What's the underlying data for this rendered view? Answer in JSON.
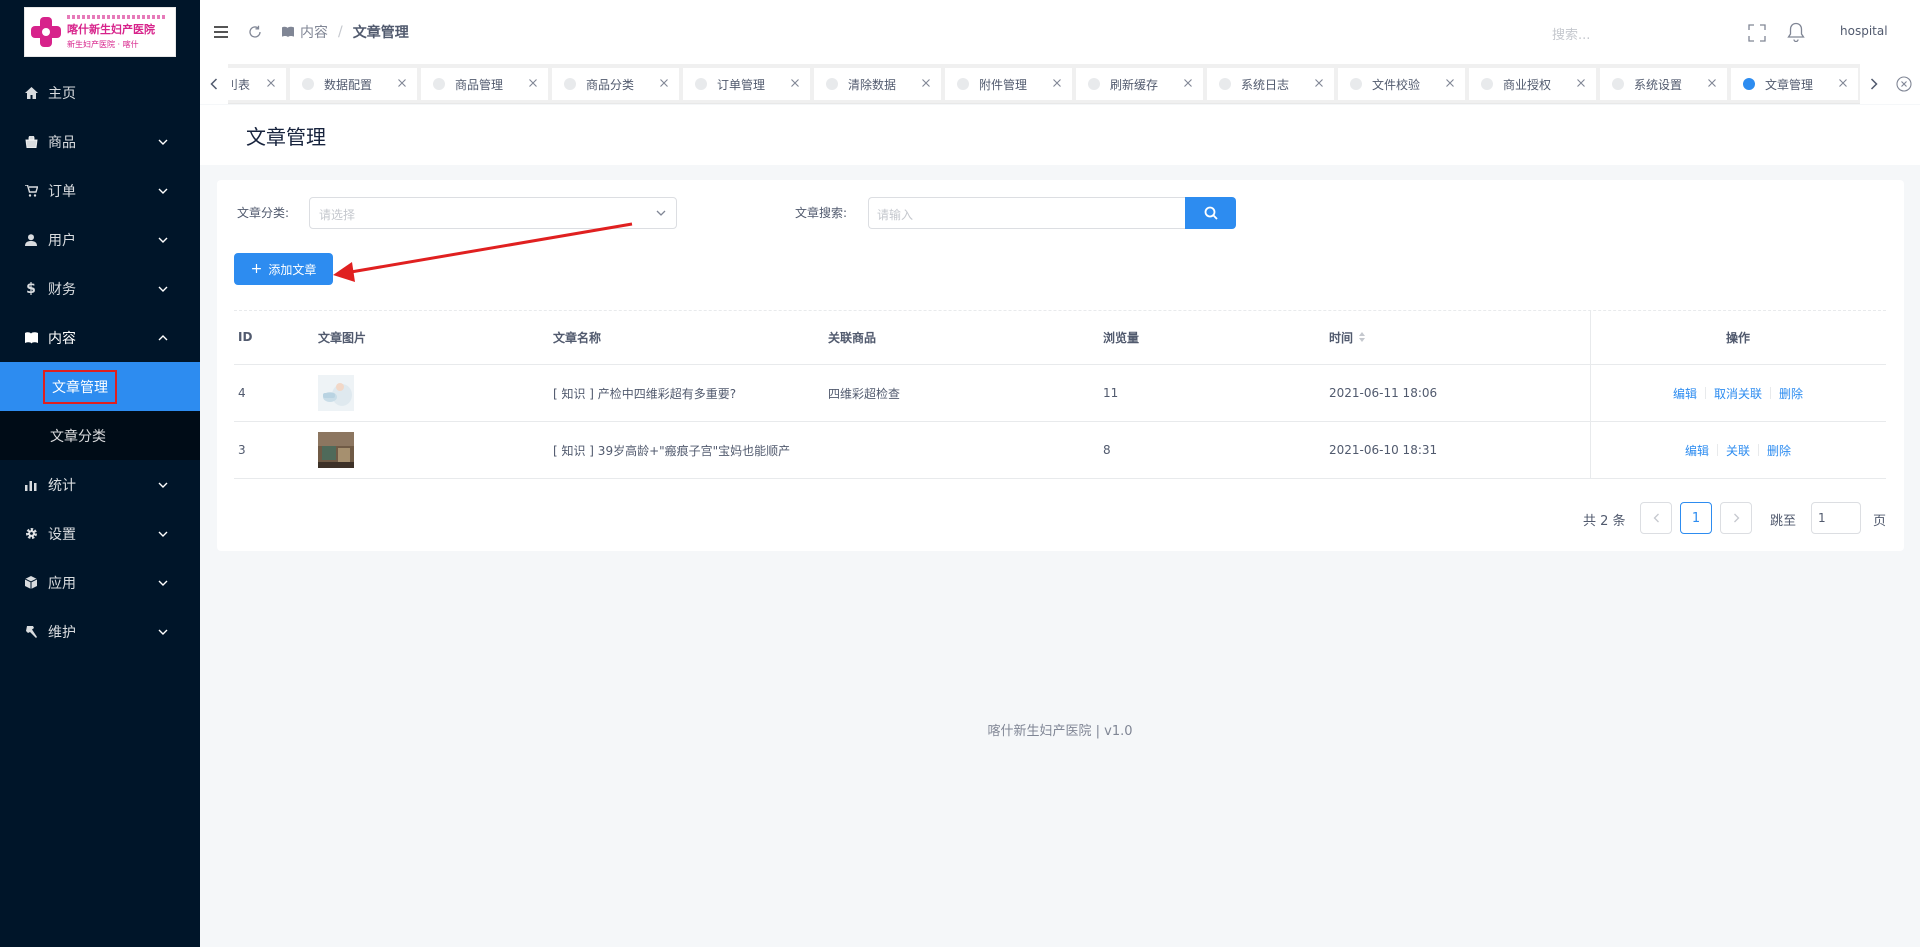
{
  "brand": {
    "logo_line1": "喀什新生妇产医院",
    "logo_line2": "新生妇产医院 · 喀什"
  },
  "sidebar": {
    "items": [
      {
        "label": "主页",
        "icon": "home-icon",
        "has_children": false
      },
      {
        "label": "商品",
        "icon": "shop-icon",
        "has_children": true
      },
      {
        "label": "订单",
        "icon": "cart-icon",
        "has_children": true
      },
      {
        "label": "用户",
        "icon": "user-icon",
        "has_children": true
      },
      {
        "label": "财务",
        "icon": "dollar-icon",
        "has_children": true
      },
      {
        "label": "内容",
        "icon": "book-icon",
        "has_children": true,
        "open": true,
        "children": [
          {
            "label": "文章管理",
            "active": true
          },
          {
            "label": "文章分类",
            "active": false
          }
        ]
      },
      {
        "label": "统计",
        "icon": "chart-icon",
        "has_children": true
      },
      {
        "label": "设置",
        "icon": "gear-icon",
        "has_children": true
      },
      {
        "label": "应用",
        "icon": "cube-icon",
        "has_children": true
      },
      {
        "label": "维护",
        "icon": "hammer-icon",
        "has_children": true
      }
    ]
  },
  "header": {
    "breadcrumb": [
      "内容",
      "文章管理"
    ],
    "search_placeholder": "搜索...",
    "user": "hospital"
  },
  "tabs": [
    {
      "label": "刂表",
      "active": false
    },
    {
      "label": "数据配置",
      "active": false
    },
    {
      "label": "商品管理",
      "active": false
    },
    {
      "label": "商品分类",
      "active": false
    },
    {
      "label": "订单管理",
      "active": false
    },
    {
      "label": "清除数据",
      "active": false
    },
    {
      "label": "附件管理",
      "active": false
    },
    {
      "label": "刷新缓存",
      "active": false
    },
    {
      "label": "系统日志",
      "active": false
    },
    {
      "label": "文件校验",
      "active": false
    },
    {
      "label": "商业授权",
      "active": false
    },
    {
      "label": "系统设置",
      "active": false
    },
    {
      "label": "文章管理",
      "active": true
    }
  ],
  "page": {
    "title": "文章管理"
  },
  "filters": {
    "category_label": "文章分类:",
    "category_placeholder": "请选择",
    "search_label": "文章搜索:",
    "search_placeholder": "请输入",
    "add_button": "添加文章"
  },
  "table": {
    "columns": [
      "ID",
      "文章图片",
      "文章名称",
      "关联商品",
      "浏览量",
      "时间",
      "操作"
    ],
    "rows": [
      {
        "id": "4",
        "title": "[ 知识 ] 产检中四维彩超有多重要?",
        "product": "四维彩超检查",
        "views": "11",
        "time": "2021-06-11 18:06",
        "ops": [
          "编辑",
          "取消关联",
          "删除"
        ]
      },
      {
        "id": "3",
        "title": "[ 知识 ] 39岁高龄+\"瘢痕子宫\"宝妈也能顺产",
        "product": "",
        "views": "8",
        "time": "2021-06-10 18:31",
        "ops": [
          "编辑",
          "关联",
          "删除"
        ]
      }
    ]
  },
  "pagination": {
    "total_text": "共 2 条",
    "current_page": "1",
    "jump_label": "跳至",
    "jump_value": "1",
    "page_suffix": "页"
  },
  "footer": {
    "text": "喀什新生妇产医院 | v1.0"
  },
  "colors": {
    "sidebar_bg": "#001529",
    "primary": "#2d8cf0",
    "annotation_red": "#e02020"
  }
}
